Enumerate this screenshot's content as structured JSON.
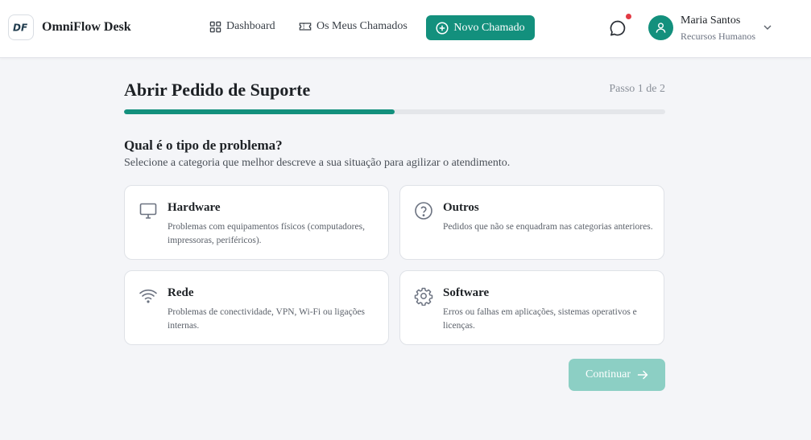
{
  "header": {
    "logo_text": "DF",
    "brand": "OmniFlow Desk",
    "nav": [
      {
        "label": "Dashboard",
        "icon": "grid-icon"
      },
      {
        "label": "Os Meus Chamados",
        "icon": "ticket-icon"
      }
    ],
    "new_ticket_label": "Novo Chamado",
    "notifications_icon": "chat-bubble-icon",
    "user": {
      "name": "Maria Santos",
      "department": "Recursos Humanos"
    }
  },
  "wizard": {
    "title": "Abrir Pedido de Suporte",
    "step": "Passo 1 de 2",
    "progress": 0.5,
    "question": "Qual é o tipo de problema?",
    "instructions": "Selecione a categoria que melhor descreve a sua situação para agilizar o atendimento.",
    "categories": [
      {
        "title": "Hardware",
        "description": "Problemas com equipamentos físicos (computadores, impressoras, periféricos).",
        "icon": "monitor-icon"
      },
      {
        "title": "Outros",
        "description": "Pedidos que não se enquadram nas categorias anteriores.",
        "icon": "help-circle-icon"
      },
      {
        "title": "Rede",
        "description": "Problemas de conectividade, VPN, Wi-Fi ou ligações internas.",
        "icon": "wifi-icon"
      },
      {
        "title": "Software",
        "description": "Erros ou falhas em aplicações, sistemas operativos e licenças.",
        "icon": "settings-gear-icon"
      }
    ],
    "continue_label": "Continuar"
  },
  "colors": {
    "primary": "#13907d",
    "primary_disabled": "#8ccfc4",
    "notification": "#e23a44",
    "background": "#f4f5f8"
  }
}
